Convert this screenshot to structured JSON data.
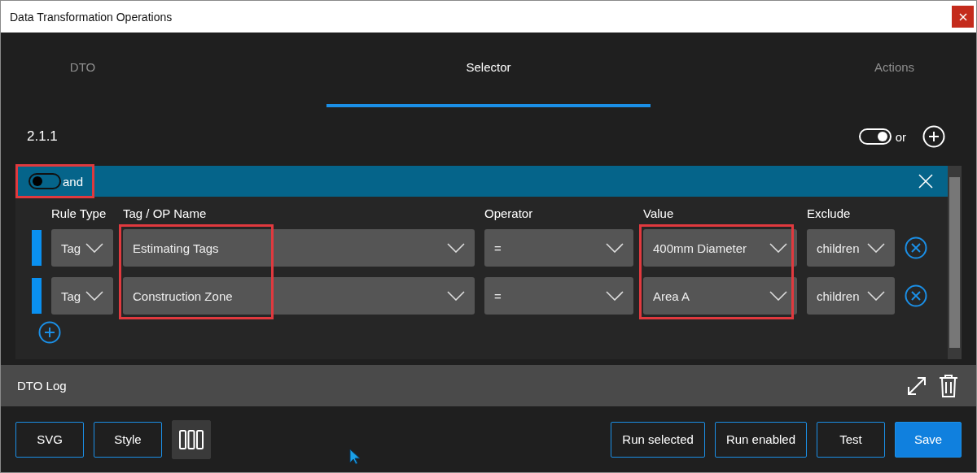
{
  "window": {
    "title": "Data Transformation Operations"
  },
  "tabs": [
    {
      "label": "DTO",
      "selected": false
    },
    {
      "label": "Selector",
      "selected": true
    },
    {
      "label": "Actions",
      "selected": false
    }
  ],
  "group": {
    "label": "2.1.1",
    "or_toggle": {
      "label": "or",
      "on": true
    },
    "and_toggle": {
      "label": "and",
      "on": false,
      "highlighted": true
    }
  },
  "columns": [
    {
      "label": "Rule Type",
      "highlighted": false
    },
    {
      "label": "Tag / OP Name",
      "highlighted": true
    },
    {
      "label": "Operator",
      "highlighted": false
    },
    {
      "label": "Value",
      "highlighted": true
    },
    {
      "label": "Exclude",
      "highlighted": false
    }
  ],
  "rows": [
    {
      "cells": [
        "Tag",
        "Estimating Tags",
        "=",
        "400mm Diameter",
        "children"
      ]
    },
    {
      "cells": [
        "Tag",
        "Construction Zone",
        "=",
        "Area A",
        "children"
      ]
    }
  ],
  "log": {
    "title": "DTO Log"
  },
  "buttons": [
    {
      "label": "SVG",
      "kind": "outline"
    },
    {
      "label": "Style",
      "kind": "outline"
    },
    {
      "kind": "columns"
    },
    {
      "label": "Run selected",
      "kind": "outline"
    },
    {
      "label": "Run enabled",
      "kind": "outline"
    },
    {
      "label": "Test",
      "kind": "outline"
    },
    {
      "label": "Save",
      "kind": "primary"
    }
  ]
}
